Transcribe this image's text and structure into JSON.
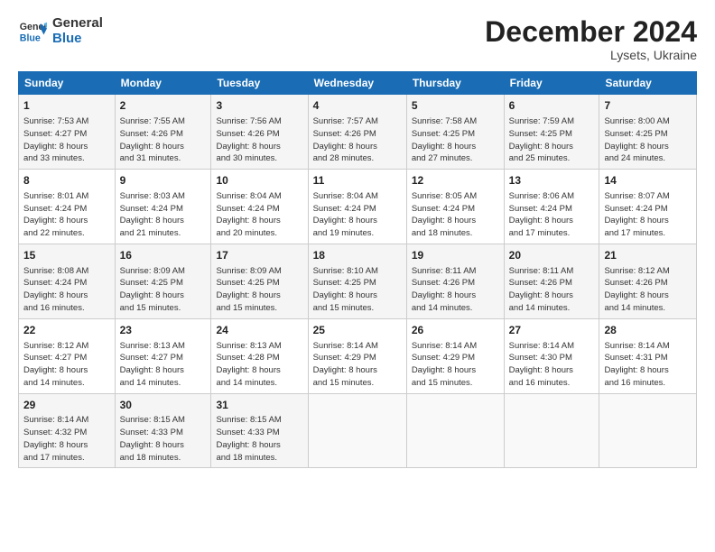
{
  "logo": {
    "line1": "General",
    "line2": "Blue"
  },
  "title": "December 2024",
  "subtitle": "Lysets, Ukraine",
  "days_of_week": [
    "Sunday",
    "Monday",
    "Tuesday",
    "Wednesday",
    "Thursday",
    "Friday",
    "Saturday"
  ],
  "weeks": [
    [
      {
        "day": "1",
        "detail": "Sunrise: 7:53 AM\nSunset: 4:27 PM\nDaylight: 8 hours\nand 33 minutes."
      },
      {
        "day": "2",
        "detail": "Sunrise: 7:55 AM\nSunset: 4:26 PM\nDaylight: 8 hours\nand 31 minutes."
      },
      {
        "day": "3",
        "detail": "Sunrise: 7:56 AM\nSunset: 4:26 PM\nDaylight: 8 hours\nand 30 minutes."
      },
      {
        "day": "4",
        "detail": "Sunrise: 7:57 AM\nSunset: 4:26 PM\nDaylight: 8 hours\nand 28 minutes."
      },
      {
        "day": "5",
        "detail": "Sunrise: 7:58 AM\nSunset: 4:25 PM\nDaylight: 8 hours\nand 27 minutes."
      },
      {
        "day": "6",
        "detail": "Sunrise: 7:59 AM\nSunset: 4:25 PM\nDaylight: 8 hours\nand 25 minutes."
      },
      {
        "day": "7",
        "detail": "Sunrise: 8:00 AM\nSunset: 4:25 PM\nDaylight: 8 hours\nand 24 minutes."
      }
    ],
    [
      {
        "day": "8",
        "detail": "Sunrise: 8:01 AM\nSunset: 4:24 PM\nDaylight: 8 hours\nand 22 minutes."
      },
      {
        "day": "9",
        "detail": "Sunrise: 8:03 AM\nSunset: 4:24 PM\nDaylight: 8 hours\nand 21 minutes."
      },
      {
        "day": "10",
        "detail": "Sunrise: 8:04 AM\nSunset: 4:24 PM\nDaylight: 8 hours\nand 20 minutes."
      },
      {
        "day": "11",
        "detail": "Sunrise: 8:04 AM\nSunset: 4:24 PM\nDaylight: 8 hours\nand 19 minutes."
      },
      {
        "day": "12",
        "detail": "Sunrise: 8:05 AM\nSunset: 4:24 PM\nDaylight: 8 hours\nand 18 minutes."
      },
      {
        "day": "13",
        "detail": "Sunrise: 8:06 AM\nSunset: 4:24 PM\nDaylight: 8 hours\nand 17 minutes."
      },
      {
        "day": "14",
        "detail": "Sunrise: 8:07 AM\nSunset: 4:24 PM\nDaylight: 8 hours\nand 17 minutes."
      }
    ],
    [
      {
        "day": "15",
        "detail": "Sunrise: 8:08 AM\nSunset: 4:24 PM\nDaylight: 8 hours\nand 16 minutes."
      },
      {
        "day": "16",
        "detail": "Sunrise: 8:09 AM\nSunset: 4:25 PM\nDaylight: 8 hours\nand 15 minutes."
      },
      {
        "day": "17",
        "detail": "Sunrise: 8:09 AM\nSunset: 4:25 PM\nDaylight: 8 hours\nand 15 minutes."
      },
      {
        "day": "18",
        "detail": "Sunrise: 8:10 AM\nSunset: 4:25 PM\nDaylight: 8 hours\nand 15 minutes."
      },
      {
        "day": "19",
        "detail": "Sunrise: 8:11 AM\nSunset: 4:26 PM\nDaylight: 8 hours\nand 14 minutes."
      },
      {
        "day": "20",
        "detail": "Sunrise: 8:11 AM\nSunset: 4:26 PM\nDaylight: 8 hours\nand 14 minutes."
      },
      {
        "day": "21",
        "detail": "Sunrise: 8:12 AM\nSunset: 4:26 PM\nDaylight: 8 hours\nand 14 minutes."
      }
    ],
    [
      {
        "day": "22",
        "detail": "Sunrise: 8:12 AM\nSunset: 4:27 PM\nDaylight: 8 hours\nand 14 minutes."
      },
      {
        "day": "23",
        "detail": "Sunrise: 8:13 AM\nSunset: 4:27 PM\nDaylight: 8 hours\nand 14 minutes."
      },
      {
        "day": "24",
        "detail": "Sunrise: 8:13 AM\nSunset: 4:28 PM\nDaylight: 8 hours\nand 14 minutes."
      },
      {
        "day": "25",
        "detail": "Sunrise: 8:14 AM\nSunset: 4:29 PM\nDaylight: 8 hours\nand 15 minutes."
      },
      {
        "day": "26",
        "detail": "Sunrise: 8:14 AM\nSunset: 4:29 PM\nDaylight: 8 hours\nand 15 minutes."
      },
      {
        "day": "27",
        "detail": "Sunrise: 8:14 AM\nSunset: 4:30 PM\nDaylight: 8 hours\nand 16 minutes."
      },
      {
        "day": "28",
        "detail": "Sunrise: 8:14 AM\nSunset: 4:31 PM\nDaylight: 8 hours\nand 16 minutes."
      }
    ],
    [
      {
        "day": "29",
        "detail": "Sunrise: 8:14 AM\nSunset: 4:32 PM\nDaylight: 8 hours\nand 17 minutes."
      },
      {
        "day": "30",
        "detail": "Sunrise: 8:15 AM\nSunset: 4:33 PM\nDaylight: 8 hours\nand 18 minutes."
      },
      {
        "day": "31",
        "detail": "Sunrise: 8:15 AM\nSunset: 4:33 PM\nDaylight: 8 hours\nand 18 minutes."
      },
      {
        "day": "",
        "detail": ""
      },
      {
        "day": "",
        "detail": ""
      },
      {
        "day": "",
        "detail": ""
      },
      {
        "day": "",
        "detail": ""
      }
    ]
  ]
}
